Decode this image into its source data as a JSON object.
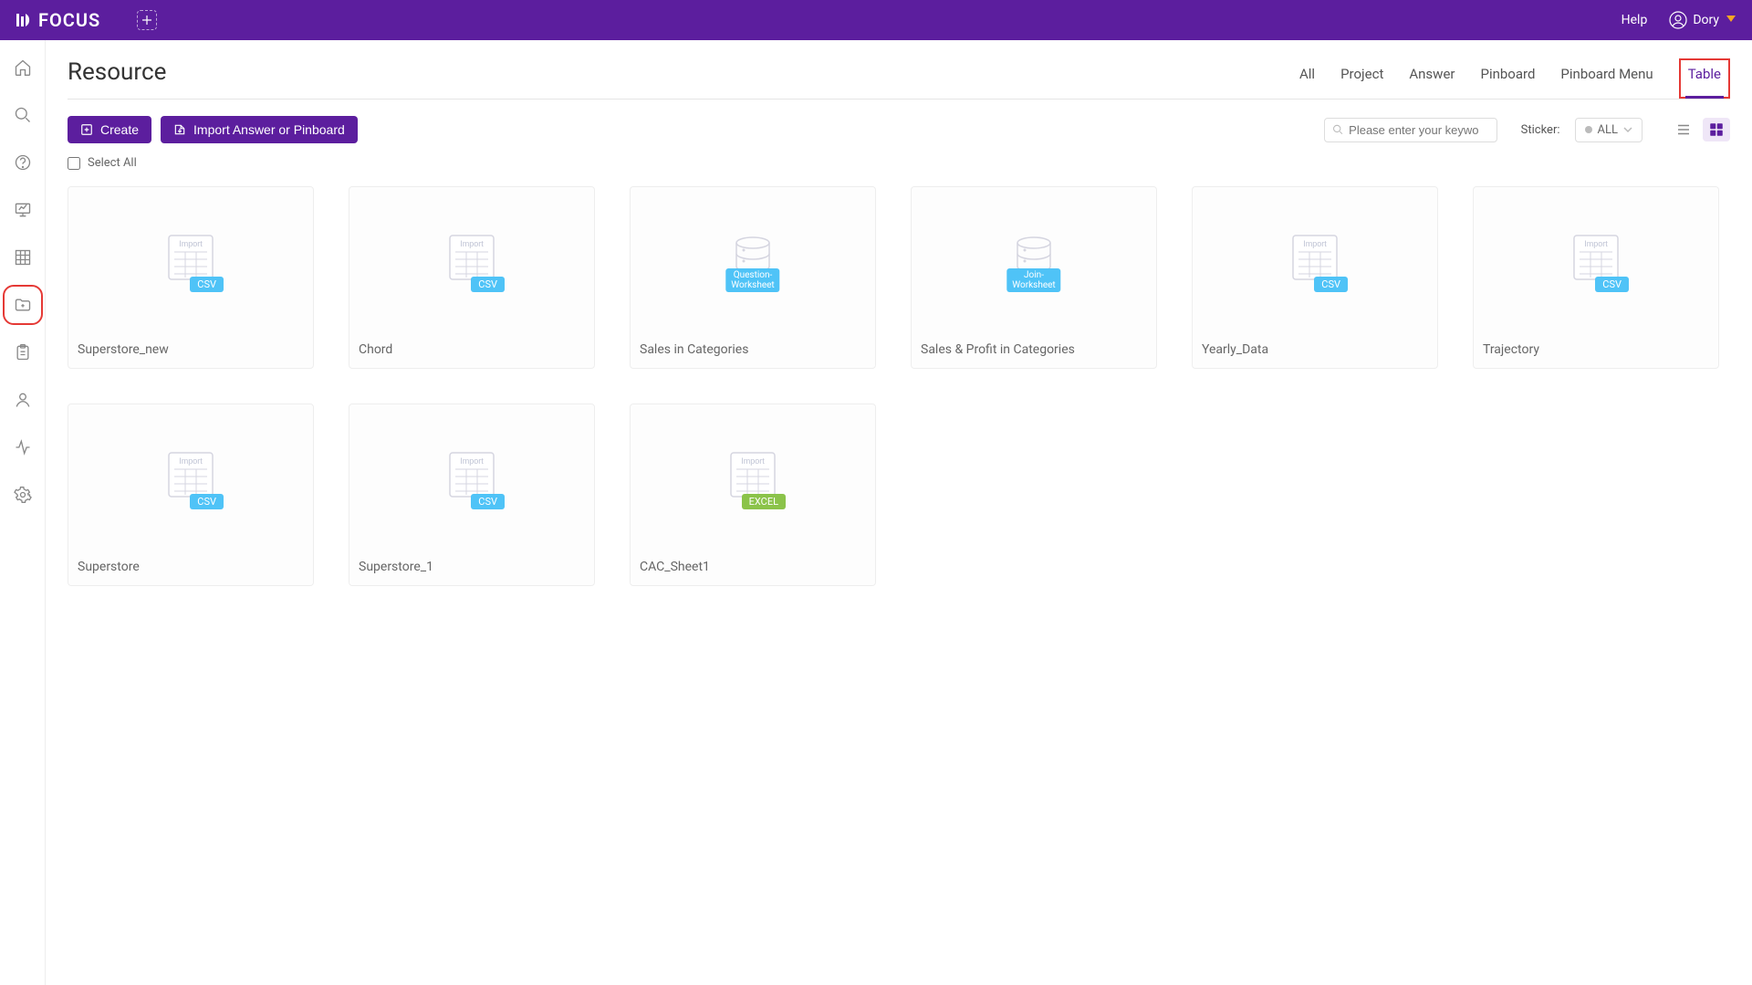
{
  "header": {
    "logo": "FOCUS",
    "help_label": "Help",
    "user_name": "Dory"
  },
  "page": {
    "title": "Resource"
  },
  "tabs": [
    {
      "label": "All",
      "active": false
    },
    {
      "label": "Project",
      "active": false
    },
    {
      "label": "Answer",
      "active": false
    },
    {
      "label": "Pinboard",
      "active": false
    },
    {
      "label": "Pinboard Menu",
      "active": false
    },
    {
      "label": "Table",
      "active": true
    }
  ],
  "toolbar": {
    "create_label": "Create",
    "import_label": "Import Answer or Pinboard",
    "search_placeholder": "Please enter your keywo",
    "sticker_label": "Sticker:",
    "sticker_value": "ALL"
  },
  "select_all": "Select All",
  "resources": [
    {
      "name": "Superstore_new",
      "type": "csv"
    },
    {
      "name": "Chord",
      "type": "csv"
    },
    {
      "name": "Sales in Categories",
      "type": "question-worksheet"
    },
    {
      "name": "Sales & Profit in Categories",
      "type": "join-worksheet"
    },
    {
      "name": "Yearly_Data",
      "type": "csv"
    },
    {
      "name": "Trajectory",
      "type": "csv"
    },
    {
      "name": "Superstore",
      "type": "csv"
    },
    {
      "name": "Superstore_1",
      "type": "csv"
    },
    {
      "name": "CAC_Sheet1",
      "type": "excel"
    }
  ],
  "type_labels": {
    "csv": "CSV",
    "excel": "EXCEL",
    "question-worksheet": "Question-\nWorksheet",
    "join-worksheet": "Join-\nWorksheet"
  },
  "import_text": "Import"
}
